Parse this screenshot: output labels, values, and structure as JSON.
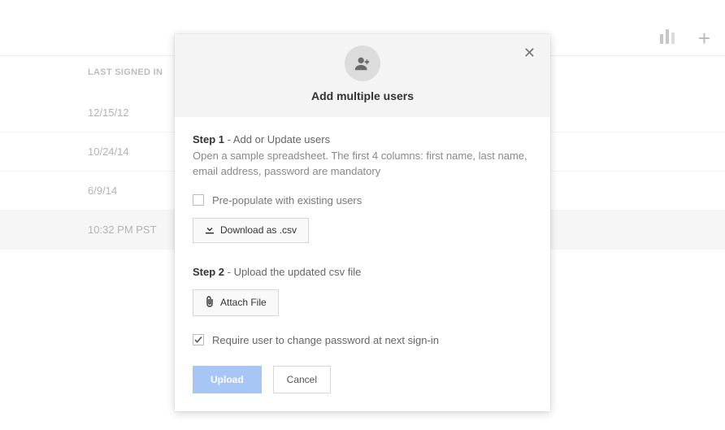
{
  "bg": {
    "column_header": "LAST SIGNED IN",
    "rows": [
      "12/15/12",
      "10/24/14",
      "6/9/14",
      "10:32 PM PST"
    ]
  },
  "modal": {
    "title": "Add multiple users",
    "step1": {
      "prefix": "Step 1",
      "title": " - Add or Update users",
      "desc": "Open a sample spreadsheet. The first 4 columns: first name, last name, email address, password are mandatory",
      "prepopulate_label": "Pre-populate with existing users",
      "download_label": "Download as .csv"
    },
    "step2": {
      "prefix": "Step 2",
      "title": " - Upload the updated csv file",
      "attach_label": "Attach File"
    },
    "require_change_label": "Require user to change password at next sign-in",
    "upload_label": "Upload",
    "cancel_label": "Cancel"
  }
}
